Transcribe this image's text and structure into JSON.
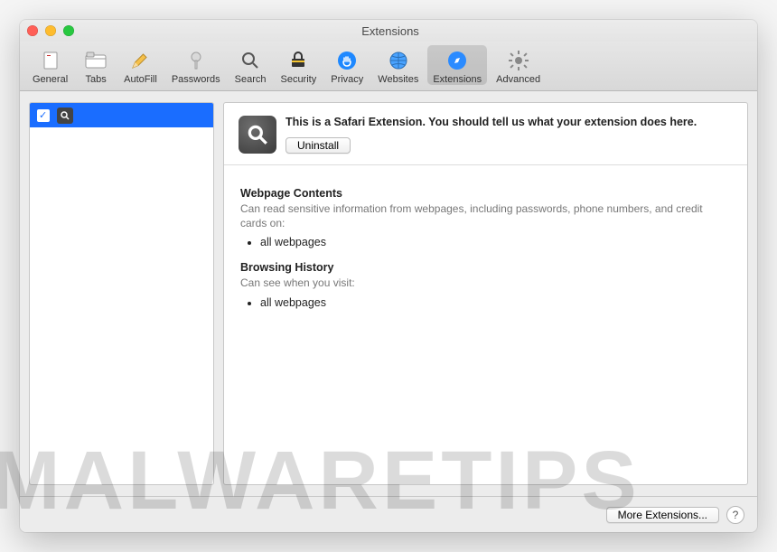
{
  "window": {
    "title": "Extensions"
  },
  "toolbar": {
    "items": [
      {
        "label": "General"
      },
      {
        "label": "Tabs"
      },
      {
        "label": "AutoFill"
      },
      {
        "label": "Passwords"
      },
      {
        "label": "Search"
      },
      {
        "label": "Security"
      },
      {
        "label": "Privacy"
      },
      {
        "label": "Websites"
      },
      {
        "label": "Extensions"
      },
      {
        "label": "Advanced"
      }
    ]
  },
  "sidebar": {
    "items": [
      {
        "checked": true
      }
    ]
  },
  "detail": {
    "description": "This is a Safari Extension. You should tell us what your extension does here.",
    "uninstall_label": "Uninstall",
    "perms": {
      "webpage_heading": "Webpage Contents",
      "webpage_sub": "Can read sensitive information from webpages, including passwords, phone numbers, and credit cards on:",
      "webpage_item": "all webpages",
      "history_heading": "Browsing History",
      "history_sub": "Can see when you visit:",
      "history_item": "all webpages"
    }
  },
  "footer": {
    "more_label": "More Extensions...",
    "help_label": "?"
  },
  "watermark": "MALWARETIPS"
}
